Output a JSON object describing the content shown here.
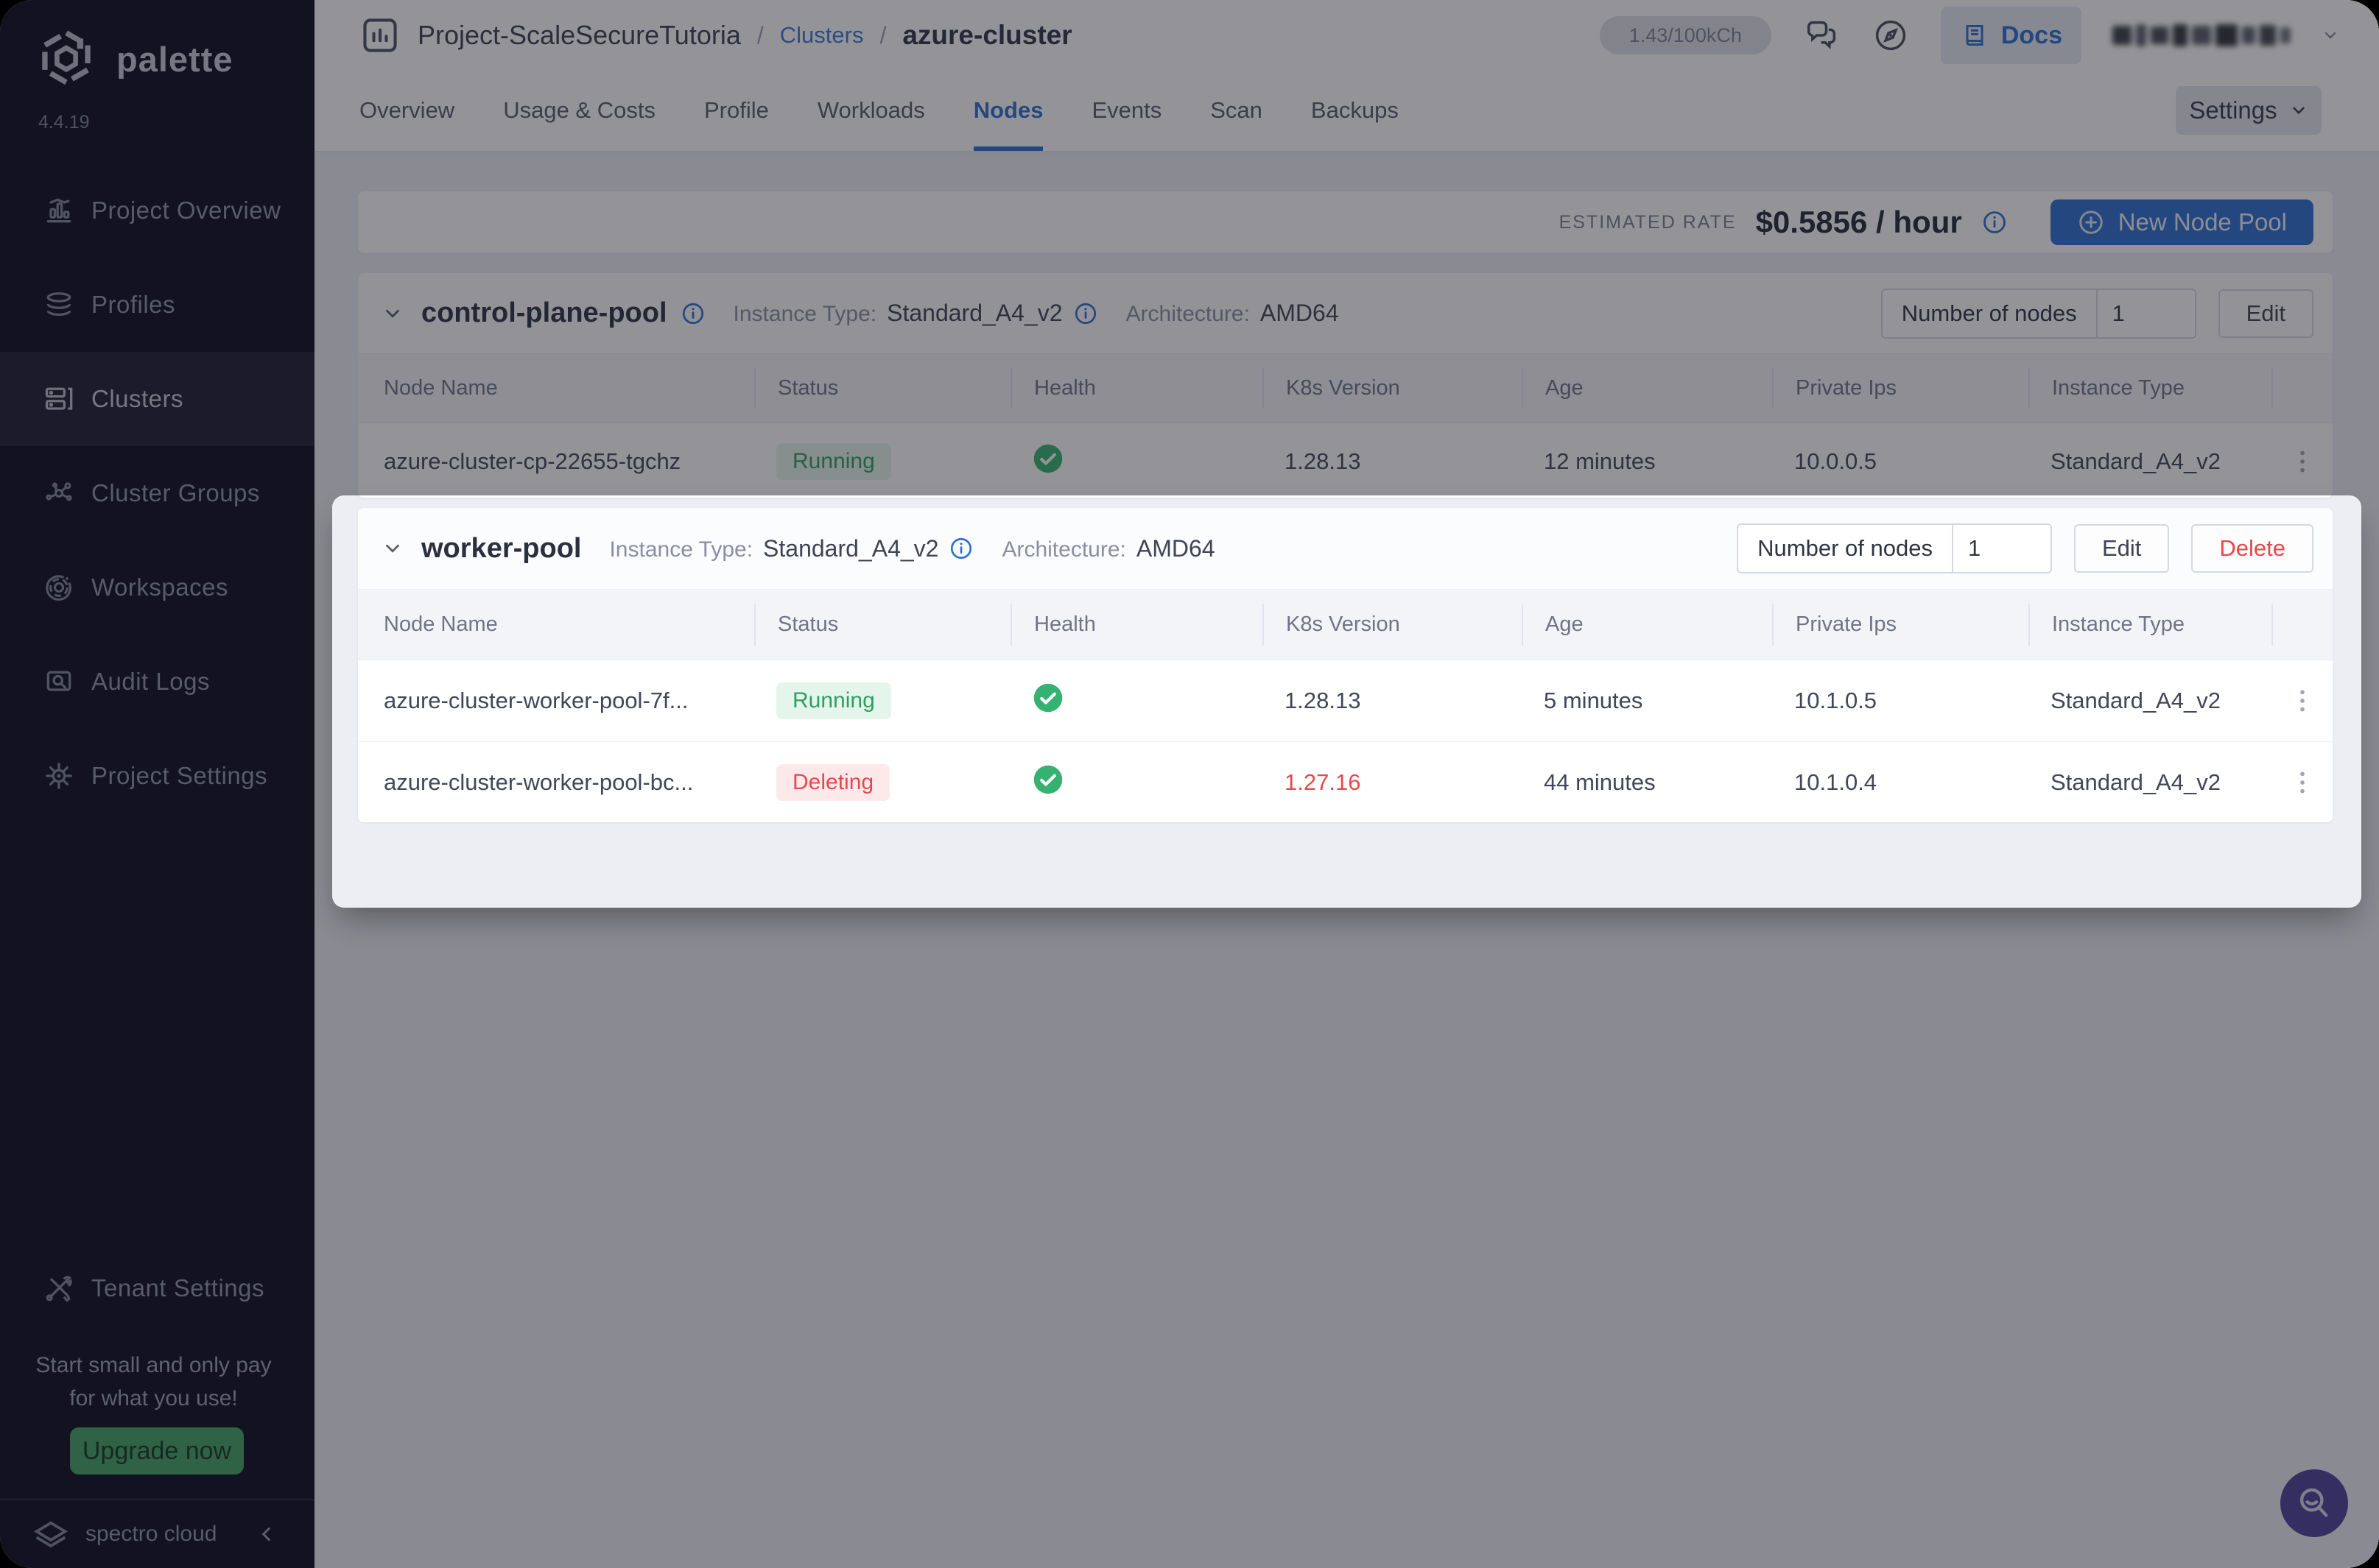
{
  "brand": {
    "name": "palette",
    "version": "4.4.19",
    "footer": "spectro cloud"
  },
  "sidebar": {
    "items": [
      {
        "label": "Project Overview"
      },
      {
        "label": "Profiles"
      },
      {
        "label": "Clusters"
      },
      {
        "label": "Cluster Groups"
      },
      {
        "label": "Workspaces"
      },
      {
        "label": "Audit Logs"
      },
      {
        "label": "Project Settings"
      }
    ],
    "tenant_settings": "Tenant Settings",
    "promo_line1": "Start small and only pay",
    "promo_line2": "for what you use!",
    "upgrade_label": "Upgrade now"
  },
  "header": {
    "project": "Project-ScaleSecureTutoria",
    "sep1": "/",
    "clusters_link": "Clusters",
    "sep2": "/",
    "cluster_name": "azure-cluster",
    "usage_badge": "1.43/100kCh",
    "docs_label": "Docs"
  },
  "tabs": {
    "items": [
      "Overview",
      "Usage & Costs",
      "Profile",
      "Workloads",
      "Nodes",
      "Events",
      "Scan",
      "Backups"
    ],
    "active": "Nodes",
    "settings_label": "Settings"
  },
  "ratebar": {
    "label": "ESTIMATED RATE",
    "value": "$0.5856 / hour",
    "new_node_pool": "New Node Pool"
  },
  "table": {
    "headers": [
      "Node Name",
      "Status",
      "Health",
      "K8s Version",
      "Age",
      "Private Ips",
      "Instance Type"
    ]
  },
  "pools": [
    {
      "name": "control-plane-pool",
      "instance_type_label": "Instance Type:",
      "instance_type": "Standard_A4_v2",
      "architecture_label": "Architecture:",
      "architecture": "AMD64",
      "nodes_label": "Number of nodes",
      "nodes_count": "1",
      "edit_label": "Edit",
      "rows": [
        {
          "name": "azure-cluster-cp-22655-tgchz",
          "status": "Running",
          "k8s": "1.28.13",
          "age": "12 minutes",
          "ip": "10.0.0.5",
          "instance": "Standard_A4_v2"
        }
      ]
    },
    {
      "name": "worker-pool",
      "instance_type_label": "Instance Type:",
      "instance_type": "Standard_A4_v2",
      "architecture_label": "Architecture:",
      "architecture": "AMD64",
      "nodes_label": "Number of nodes",
      "nodes_count": "1",
      "edit_label": "Edit",
      "delete_label": "Delete",
      "rows": [
        {
          "name": "azure-cluster-worker-pool-7f...",
          "status": "Running",
          "k8s": "1.28.13",
          "age": "5 minutes",
          "ip": "10.1.0.5",
          "instance": "Standard_A4_v2"
        },
        {
          "name": "azure-cluster-worker-pool-bc...",
          "status": "Deleting",
          "k8s": "1.27.16",
          "age": "44 minutes",
          "ip": "10.1.0.4",
          "instance": "Standard_A4_v2"
        }
      ]
    }
  ],
  "colors": {
    "accent_blue": "#2e6fd0",
    "status_green": "#2f9e63",
    "status_red": "#e5484d",
    "fab_purple": "#4c3f97",
    "upgrade_green": "#42a065"
  }
}
